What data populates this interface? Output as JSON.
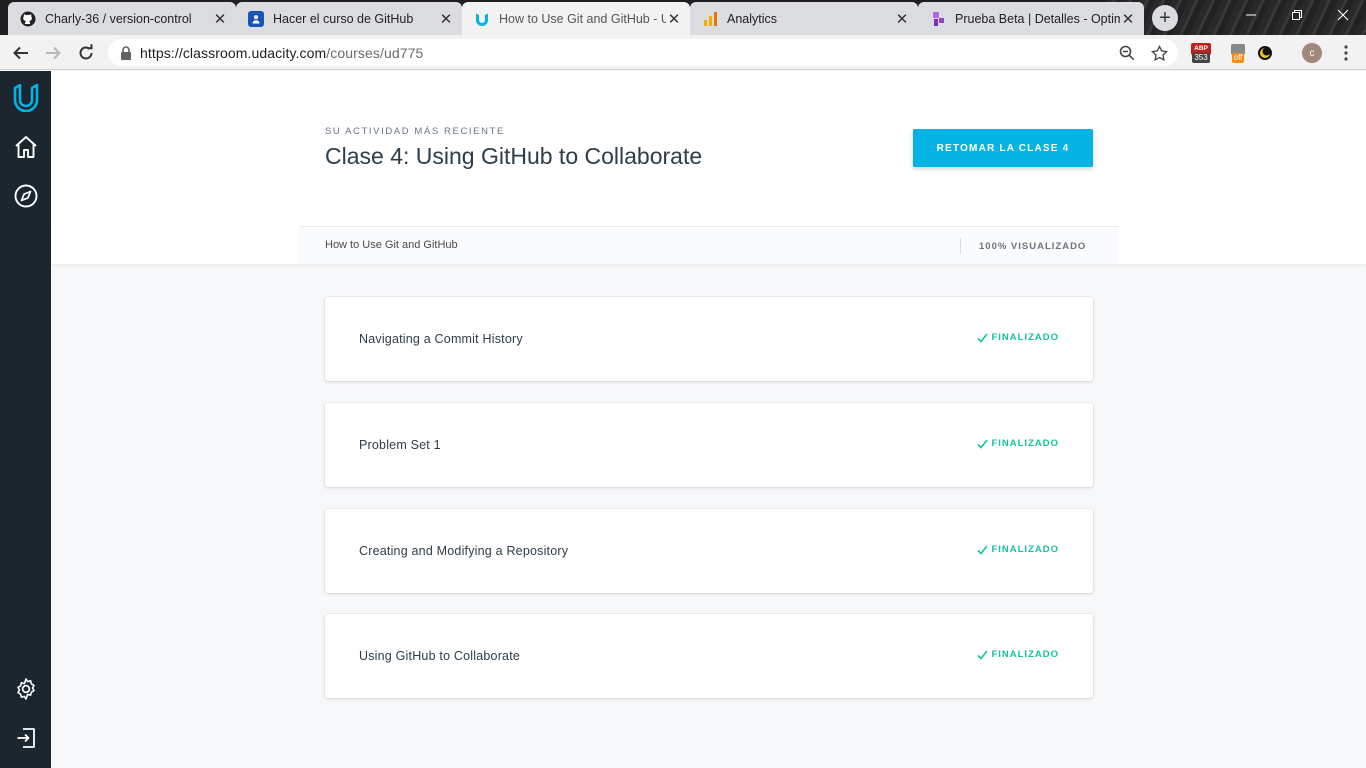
{
  "browser": {
    "tabs": [
      {
        "title": "Charly-36 / version-control",
        "icon": "github-icon",
        "active": false
      },
      {
        "title": "Hacer el curso de GitHub",
        "icon": "contact-icon",
        "active": false
      },
      {
        "title": "How to Use Git and GitHub - U",
        "icon": "udacity-icon",
        "active": true
      },
      {
        "title": "Analytics",
        "icon": "analytics-icon",
        "active": false
      },
      {
        "title": "Prueba Beta | Detalles - Optim",
        "icon": "optimize-icon",
        "active": false
      }
    ],
    "url": {
      "host": "https://classroom.udacity.com",
      "path": "/courses/ud775"
    },
    "extensions": {
      "adblock_count": "353",
      "adblock_label": "ABP",
      "off_badge": "off",
      "avatar_letter": "c"
    }
  },
  "sidebar": {
    "items": [
      {
        "name": "udacity-logo-icon"
      },
      {
        "name": "home-icon"
      },
      {
        "name": "compass-icon"
      },
      {
        "name": "settings-icon"
      },
      {
        "name": "logout-icon"
      }
    ]
  },
  "hero": {
    "eyebrow": "SU ACTIVIDAD MÁS RECIENTE",
    "title": "Clase 4: Using GitHub to Collaborate",
    "resume_label": "RETOMAR LA CLASE 4"
  },
  "progress": {
    "course_name": "How to Use Git and GitHub",
    "value": "100% VISUALIZADO"
  },
  "lessons": [
    {
      "title": "Navigating a Commit History",
      "status": "FINALIZADO"
    },
    {
      "title": "Problem Set 1",
      "status": "FINALIZADO"
    },
    {
      "title": "Creating and Modifying a Repository",
      "status": "FINALIZADO"
    },
    {
      "title": "Using GitHub to Collaborate",
      "status": "FINALIZADO"
    }
  ],
  "colors": {
    "accent": "#02b3e4",
    "success": "#15c39a",
    "sidebar": "#1c262f",
    "title": "#2e3d49"
  }
}
